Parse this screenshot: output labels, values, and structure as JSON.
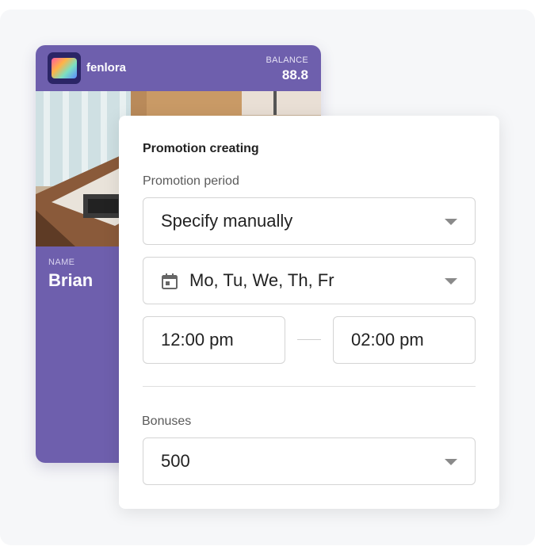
{
  "card": {
    "brand": "fenlora",
    "balance_label": "BALANCE",
    "balance_value": "88.8",
    "name_label": "NAME",
    "name_value": "Brian",
    "accent_color": "#6e5fad"
  },
  "form": {
    "title": "Promotion creating",
    "period_label": "Promotion period",
    "period_value": "Specify manually",
    "days_value": "Mo, Tu, We, Th, Fr",
    "start_time": "12:00 pm",
    "end_time": "02:00 pm",
    "bonuses_label": "Bonuses",
    "bonuses_value": "500"
  },
  "icons": {
    "logo": "app-logo-icon",
    "calendar": "calendar-icon",
    "dropdown": "chevron-down-icon"
  }
}
